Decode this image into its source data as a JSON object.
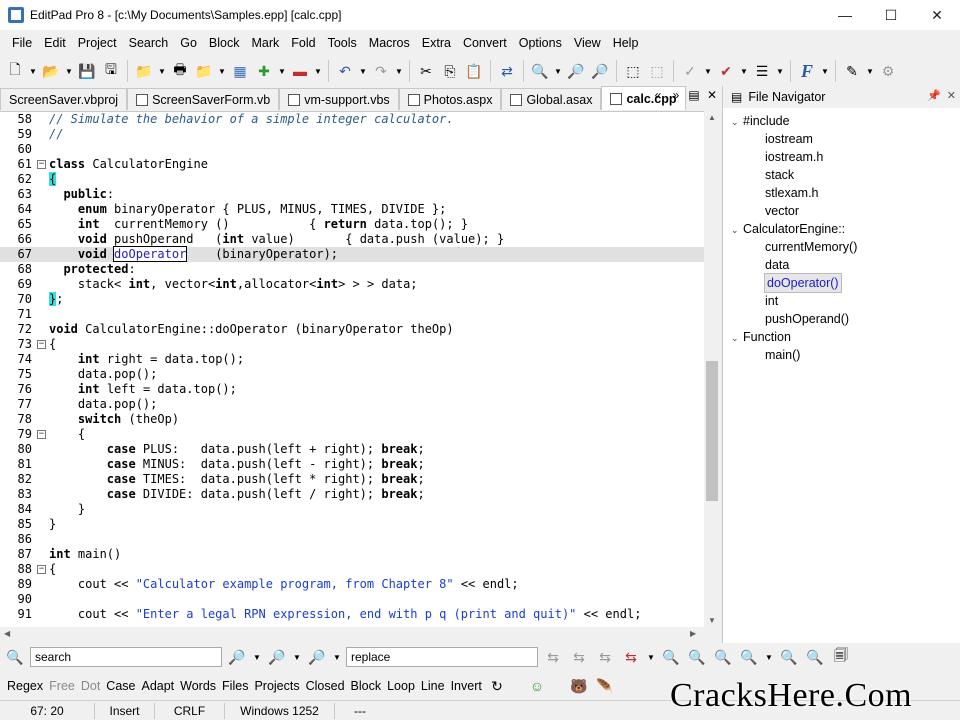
{
  "window": {
    "title": "EditPad Pro 8 - [c:\\My Documents\\Samples.epp] [calc.cpp]",
    "minimize": "—",
    "maximize": "☐",
    "close": "✕"
  },
  "menu": [
    "File",
    "Edit",
    "Project",
    "Search",
    "Go",
    "Block",
    "Mark",
    "Fold",
    "Tools",
    "Macros",
    "Extra",
    "Convert",
    "Options",
    "View",
    "Help"
  ],
  "tabs": [
    {
      "label": "ScreenSaver.vbproj",
      "active": false
    },
    {
      "label": "ScreenSaverForm.vb",
      "active": false
    },
    {
      "label": "vm-support.vbs",
      "active": false
    },
    {
      "label": "Photos.aspx",
      "active": false
    },
    {
      "label": "Global.asax",
      "active": false
    },
    {
      "label": "calc.cpp",
      "active": true
    }
  ],
  "editor": {
    "current_line": "67",
    "lines": [
      {
        "n": "58",
        "fold": "",
        "html": "<span class='cmt'>// Simulate the behavior of a simple integer calculator.</span>"
      },
      {
        "n": "59",
        "fold": "",
        "html": "<span class='cmt'>//</span>"
      },
      {
        "n": "60",
        "fold": "",
        "html": ""
      },
      {
        "n": "61",
        "fold": "-",
        "html": "<span class='kw'>class</span> CalculatorEngine"
      },
      {
        "n": "62",
        "fold": "",
        "html": "<span class='brace'>{</span>"
      },
      {
        "n": "63",
        "fold": "",
        "html": "  <span class='kw'>public</span>:"
      },
      {
        "n": "64",
        "fold": "",
        "html": "    <span class='kw'>enum</span> binaryOperator { PLUS, MINUS, TIMES, DIVIDE };"
      },
      {
        "n": "65",
        "fold": "",
        "html": "    <span class='kw'>int</span>  currentMemory ()           { <span class='kw'>return</span> data.top(); }"
      },
      {
        "n": "66",
        "fold": "",
        "html": "    <span class='kw'>void</span> pushOperand   (<span class='kw'>int</span> value)       { data.push (value); }"
      },
      {
        "n": "67",
        "fold": "",
        "html": "    <span class='kw'>void</span> <span class='sel'>doOperator</span>    (binaryOperator);"
      },
      {
        "n": "68",
        "fold": "",
        "html": "  <span class='kw'>protected</span>:"
      },
      {
        "n": "69",
        "fold": "",
        "html": "    stack&lt; <span class='kw'>int</span>, vector&lt;<span class='kw'>int</span>,allocator&lt;<span class='kw'>int</span>&gt; &gt; &gt; data;"
      },
      {
        "n": "70",
        "fold": "",
        "html": "<span class='brace'>}</span>;"
      },
      {
        "n": "71",
        "fold": "",
        "html": ""
      },
      {
        "n": "72",
        "fold": "",
        "html": "<span class='kw'>void</span> CalculatorEngine::doOperator (binaryOperator theOp)"
      },
      {
        "n": "73",
        "fold": "-",
        "html": "{"
      },
      {
        "n": "74",
        "fold": "",
        "html": "    <span class='kw'>int</span> right = data.top();"
      },
      {
        "n": "75",
        "fold": "",
        "html": "    data.pop();"
      },
      {
        "n": "76",
        "fold": "",
        "html": "    <span class='kw'>int</span> left = data.top();"
      },
      {
        "n": "77",
        "fold": "",
        "html": "    data.pop();"
      },
      {
        "n": "78",
        "fold": "",
        "html": "    <span class='kw'>switch</span> (theOp)"
      },
      {
        "n": "79",
        "fold": "-",
        "html": "    {"
      },
      {
        "n": "80",
        "fold": "",
        "html": "        <span class='kw'>case</span> PLUS:   data.push(left + right); <span class='kw'>break</span>;"
      },
      {
        "n": "81",
        "fold": "",
        "html": "        <span class='kw'>case</span> MINUS:  data.push(left - right); <span class='kw'>break</span>;"
      },
      {
        "n": "82",
        "fold": "",
        "html": "        <span class='kw'>case</span> TIMES:  data.push(left * right); <span class='kw'>break</span>;"
      },
      {
        "n": "83",
        "fold": "",
        "html": "        <span class='kw'>case</span> DIVIDE: data.push(left / right); <span class='kw'>break</span>;"
      },
      {
        "n": "84",
        "fold": "",
        "html": "    }"
      },
      {
        "n": "85",
        "fold": "",
        "html": "}"
      },
      {
        "n": "86",
        "fold": "",
        "html": ""
      },
      {
        "n": "87",
        "fold": "",
        "html": "<span class='kw'>int</span> main()"
      },
      {
        "n": "88",
        "fold": "-",
        "html": "{"
      },
      {
        "n": "89",
        "fold": "",
        "html": "    cout &lt;&lt; <span class='str'>\"Calculator example program, from Chapter 8\"</span> &lt;&lt; endl;"
      },
      {
        "n": "90",
        "fold": "",
        "html": ""
      },
      {
        "n": "91",
        "fold": "",
        "html": "    cout &lt;&lt; <span class='str'>\"Enter a legal RPN expression, end with p q (print and quit)\"</span> &lt;&lt; endl;"
      }
    ]
  },
  "navigator": {
    "title": "File Navigator",
    "nodes": [
      {
        "label": "#include",
        "level": 0,
        "expander": "⌄",
        "selected": false
      },
      {
        "label": "iostream",
        "level": 1,
        "expander": "",
        "selected": false
      },
      {
        "label": "iostream.h",
        "level": 1,
        "expander": "",
        "selected": false
      },
      {
        "label": "stack",
        "level": 1,
        "expander": "",
        "selected": false
      },
      {
        "label": "stlexam.h",
        "level": 1,
        "expander": "",
        "selected": false
      },
      {
        "label": "vector",
        "level": 1,
        "expander": "",
        "selected": false
      },
      {
        "label": "CalculatorEngine::",
        "level": 0,
        "expander": "⌄",
        "selected": false
      },
      {
        "label": "currentMemory()",
        "level": 1,
        "expander": "",
        "selected": false
      },
      {
        "label": "data",
        "level": 1,
        "expander": "",
        "selected": false
      },
      {
        "label": "doOperator()",
        "level": 1,
        "expander": "",
        "selected": true
      },
      {
        "label": "int",
        "level": 1,
        "expander": "",
        "selected": false
      },
      {
        "label": "pushOperand()",
        "level": 1,
        "expander": "",
        "selected": false
      },
      {
        "label": "Function",
        "level": 0,
        "expander": "⌄",
        "selected": false
      },
      {
        "label": "main()",
        "level": 1,
        "expander": "",
        "selected": false
      }
    ]
  },
  "search": {
    "search_value": "search",
    "replace_value": "replace"
  },
  "options": [
    {
      "label": "Regex",
      "enabled": true
    },
    {
      "label": "Free",
      "enabled": false
    },
    {
      "label": "Dot",
      "enabled": false
    },
    {
      "label": "Case",
      "enabled": true
    },
    {
      "label": "Adapt",
      "enabled": true
    },
    {
      "label": "Words",
      "enabled": true
    },
    {
      "label": "Files",
      "enabled": true
    },
    {
      "label": "Projects",
      "enabled": true
    },
    {
      "label": "Closed",
      "enabled": true
    },
    {
      "label": "Block",
      "enabled": true
    },
    {
      "label": "Loop",
      "enabled": true
    },
    {
      "label": "Line",
      "enabled": true
    },
    {
      "label": "Invert",
      "enabled": true
    }
  ],
  "status": {
    "position": "67: 20",
    "mode": "Insert",
    "line_break": "CRLF",
    "encoding": "Windows 1252",
    "extra": "---"
  },
  "watermark": "CracksHere.Com"
}
